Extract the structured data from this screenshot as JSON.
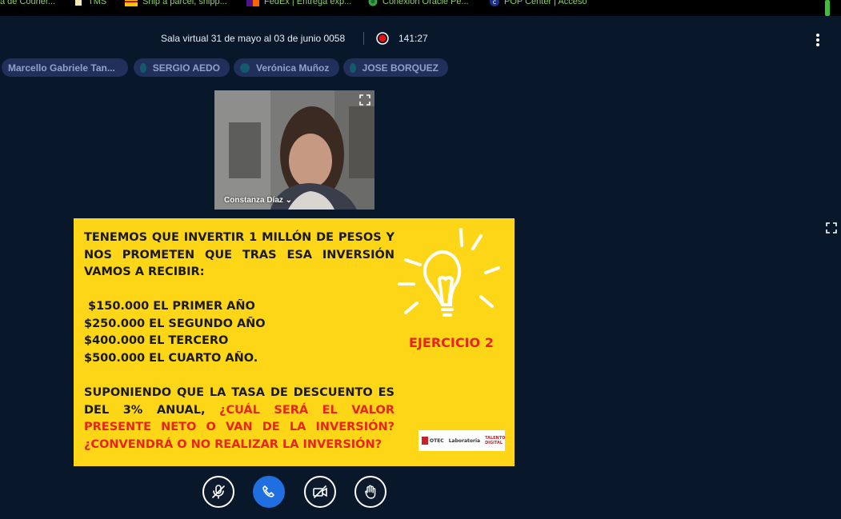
{
  "bookmarks": [
    {
      "label": "a de Courier..."
    },
    {
      "label": "TMS",
      "icon": "document-icon"
    },
    {
      "label": "Ship a parcel, shipp...",
      "icon": "dhl-icon"
    },
    {
      "label": "FedEx | Entrega exp...",
      "icon": "fedex-icon"
    },
    {
      "label": "Conexion Oracle Pe...",
      "icon": "globe-icon"
    },
    {
      "label": "POP Center | Acceso",
      "icon": "pop-icon"
    }
  ],
  "header": {
    "title": "Sala virtual 31 de mayo al 03 de junio 0058",
    "timer": "141:27"
  },
  "participants": [
    {
      "name": "Marcello Gabriele Tan..."
    },
    {
      "name": "SERGIO AEDO"
    },
    {
      "name": "Verónica Muñoz"
    },
    {
      "name": "JOSE BORQUEZ"
    }
  ],
  "video": {
    "name": "Constanza Díaz ⌄"
  },
  "slide": {
    "intro": "TENEMOS QUE INVERTIR 1 MILLÓN DE PESOS Y NOS PROMETEN QUE TRAS ESA INVERSIÓN VAMOS A RECIBIR:",
    "amounts": [
      " $150.000 EL PRIMER AÑO",
      "$250.000 EL SEGUNDO AÑO",
      "$400.000 EL TERCERO",
      "$500.000 EL CUARTO AÑO."
    ],
    "question_black": "SUPONIENDO QUE LA TASA DE DESCUENTO ES DEL 3% ANUAL, ",
    "question_red": "¿CUÁL SERÁ EL VALOR PRESENTE NETO O VAN DE LA INVERSIÓN? ¿CONVENDRÁ O NO REALIZAR LA INVERSIÓN?",
    "exercise": "EJERCICIO 2",
    "logo_otec": "OTEC",
    "logo_lab": "Laboratoria",
    "logo_talento": "TALENTO DIGITAL"
  },
  "colors": {
    "background": "#09172a",
    "slide": "#fdd617",
    "accent_red": "#e8251b",
    "call_button": "#1f6fe0",
    "chip": "#20305a"
  },
  "controls": [
    {
      "icon": "mic-off-icon"
    },
    {
      "icon": "phone-icon"
    },
    {
      "icon": "camera-off-icon"
    },
    {
      "icon": "raise-hand-icon"
    }
  ]
}
